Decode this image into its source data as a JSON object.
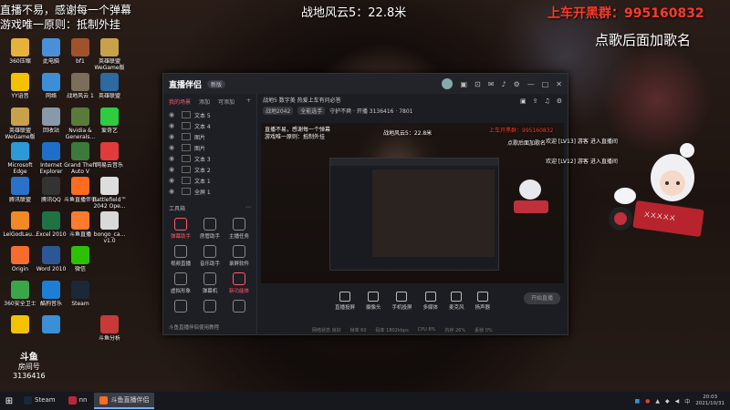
{
  "overlay": {
    "left_line1": "直播不易，感谢每一个弹幕",
    "left_line2": "游戏唯一原则：抵制外挂",
    "center": "战地风云5：22.8米",
    "red_prefix": "上车开黑群：",
    "red_number": "995160832",
    "right": "点歌后面加歌名",
    "colors": {
      "red": "#ff3a2a"
    }
  },
  "desktop_icons": [
    {
      "label": "360压缩",
      "color": "#e8b23a"
    },
    {
      "label": "此电脑",
      "color": "#4a90d9"
    },
    {
      "label": "bf1",
      "color": "#a0522d"
    },
    {
      "label": "英雄联盟WeGame版",
      "color": "#c8a24a"
    },
    {
      "label": "YY语音",
      "color": "#f2c200"
    },
    {
      "label": "网络",
      "color": "#3c8fd6"
    },
    {
      "label": "战地风云 1",
      "color": "#7a6d5a"
    },
    {
      "label": "英雄联盟",
      "color": "#2c6aa0"
    },
    {
      "label": "英雄联盟WeGame版",
      "color": "#c8a24a"
    },
    {
      "label": "回收站",
      "color": "#8899aa"
    },
    {
      "label": "Nvidia & Generals...",
      "color": "#5a7a3a"
    },
    {
      "label": "爱奇艺",
      "color": "#2ecc40"
    },
    {
      "label": "Microsoft Edge",
      "color": "#2b9ad6"
    },
    {
      "label": "Internet Explorer",
      "color": "#1e6fc9"
    },
    {
      "label": "Grand Theft Auto V",
      "color": "#3a7a3a"
    },
    {
      "label": "网易云音乐",
      "color": "#e23b3b"
    },
    {
      "label": "腾讯联盟",
      "color": "#2a72c9"
    },
    {
      "label": "腾讯QQ",
      "color": "#333333"
    },
    {
      "label": "斗鱼直播伴侣",
      "color": "#ff6b1f"
    },
    {
      "label": "Battlefield™ 2042 Ope...",
      "color": "#dddddd"
    },
    {
      "label": "LeiGodLau...",
      "color": "#f08a24"
    },
    {
      "label": "Excel 2010",
      "color": "#1f7244"
    },
    {
      "label": "斗鱼直播",
      "color": "#ff7a2a"
    },
    {
      "label": "bongo_ca... v1.0",
      "color": "#d9d9d9"
    },
    {
      "label": "Origin",
      "color": "#f56c2d"
    },
    {
      "label": "Word 2010",
      "color": "#2b5797"
    },
    {
      "label": "微信",
      "color": "#2dc100"
    },
    {
      "label": "",
      "color": "transparent"
    },
    {
      "label": "360安全卫士",
      "color": "#3aa64a"
    },
    {
      "label": "酷狗音乐",
      "color": "#1e7ed6"
    },
    {
      "label": "Steam",
      "color": "#1b2838"
    },
    {
      "label": "",
      "color": "transparent"
    },
    {
      "label": "",
      "color": "#f2c200"
    },
    {
      "label": "",
      "color": "#3a8fd6"
    },
    {
      "label": "",
      "color": "transparent"
    },
    {
      "label": "斗鱼分析",
      "color": "#c83a3a"
    }
  ],
  "app": {
    "logo": "直播伴侣",
    "version": "新版",
    "tabs": [
      "我的场景",
      "添加",
      "可添加"
    ],
    "layers": [
      "文本 5",
      "文本 4",
      "图片",
      "图片",
      "文本 3",
      "文本 2",
      "文本 1",
      "全屏 1"
    ],
    "tools_title": "工具箱",
    "tools": [
      {
        "label": "弹幕助手",
        "red": true
      },
      {
        "label": "房管助手",
        "red": false
      },
      {
        "label": "主播任务",
        "red": false
      },
      {
        "label": "视频直播",
        "red": false
      },
      {
        "label": "音乐助手",
        "red": false
      },
      {
        "label": "录屏软件",
        "red": false
      },
      {
        "label": "虚拟形象",
        "red": false
      },
      {
        "label": "弹幕机",
        "red": false
      },
      {
        "label": "新功能体",
        "red": true
      },
      {
        "label": "",
        "red": false
      },
      {
        "label": "",
        "red": false
      },
      {
        "label": "",
        "red": false
      }
    ],
    "left_footer": "斗鱼直播伴侣使用教程",
    "room_title": "战地5 数字美 热爱上车有问必答",
    "room_tags": [
      "战地2042",
      "全能选手"
    ],
    "room_meta": "守护不爽 · 开播 3136416 · 7801",
    "preview_texts": {
      "top_left": "直播不易，感谢每一个弹幕",
      "top_left2": "游戏唯一原则：抵制外挂",
      "center": "战地风云5：22.8米",
      "red": "上车开黑群：995160832",
      "right": "点歌后面加歌名"
    },
    "controls": [
      "直播投屏",
      "摄像头",
      "手机投屏",
      "多媒体",
      "麦克风",
      "扬声器"
    ],
    "start_button": "开始直播",
    "status": [
      "网络状态 良好",
      "帧率 60",
      "码率 1802kbps",
      "CPU 8%",
      "内存 26%",
      "丢帧 0%"
    ]
  },
  "danmu": [
    {
      "level": "LV13",
      "text": "欢迎 [LV13] 游客 进入直播间"
    },
    {
      "level": "LV12",
      "text": "欢迎 [LV12] 游客 进入直播间"
    }
  ],
  "watermark": {
    "logo": "斗鱼",
    "sub": "房间号",
    "room": "3136416"
  },
  "taskbar": {
    "items": [
      {
        "label": "Steam",
        "color": "#1b2838",
        "active": false
      },
      {
        "label": "nn",
        "color": "#c0243a",
        "active": false
      },
      {
        "label": "斗鱼直播伴侣",
        "color": "#ff6b1f",
        "active": true
      }
    ],
    "time": "20:03",
    "date": "2021/10/31"
  }
}
